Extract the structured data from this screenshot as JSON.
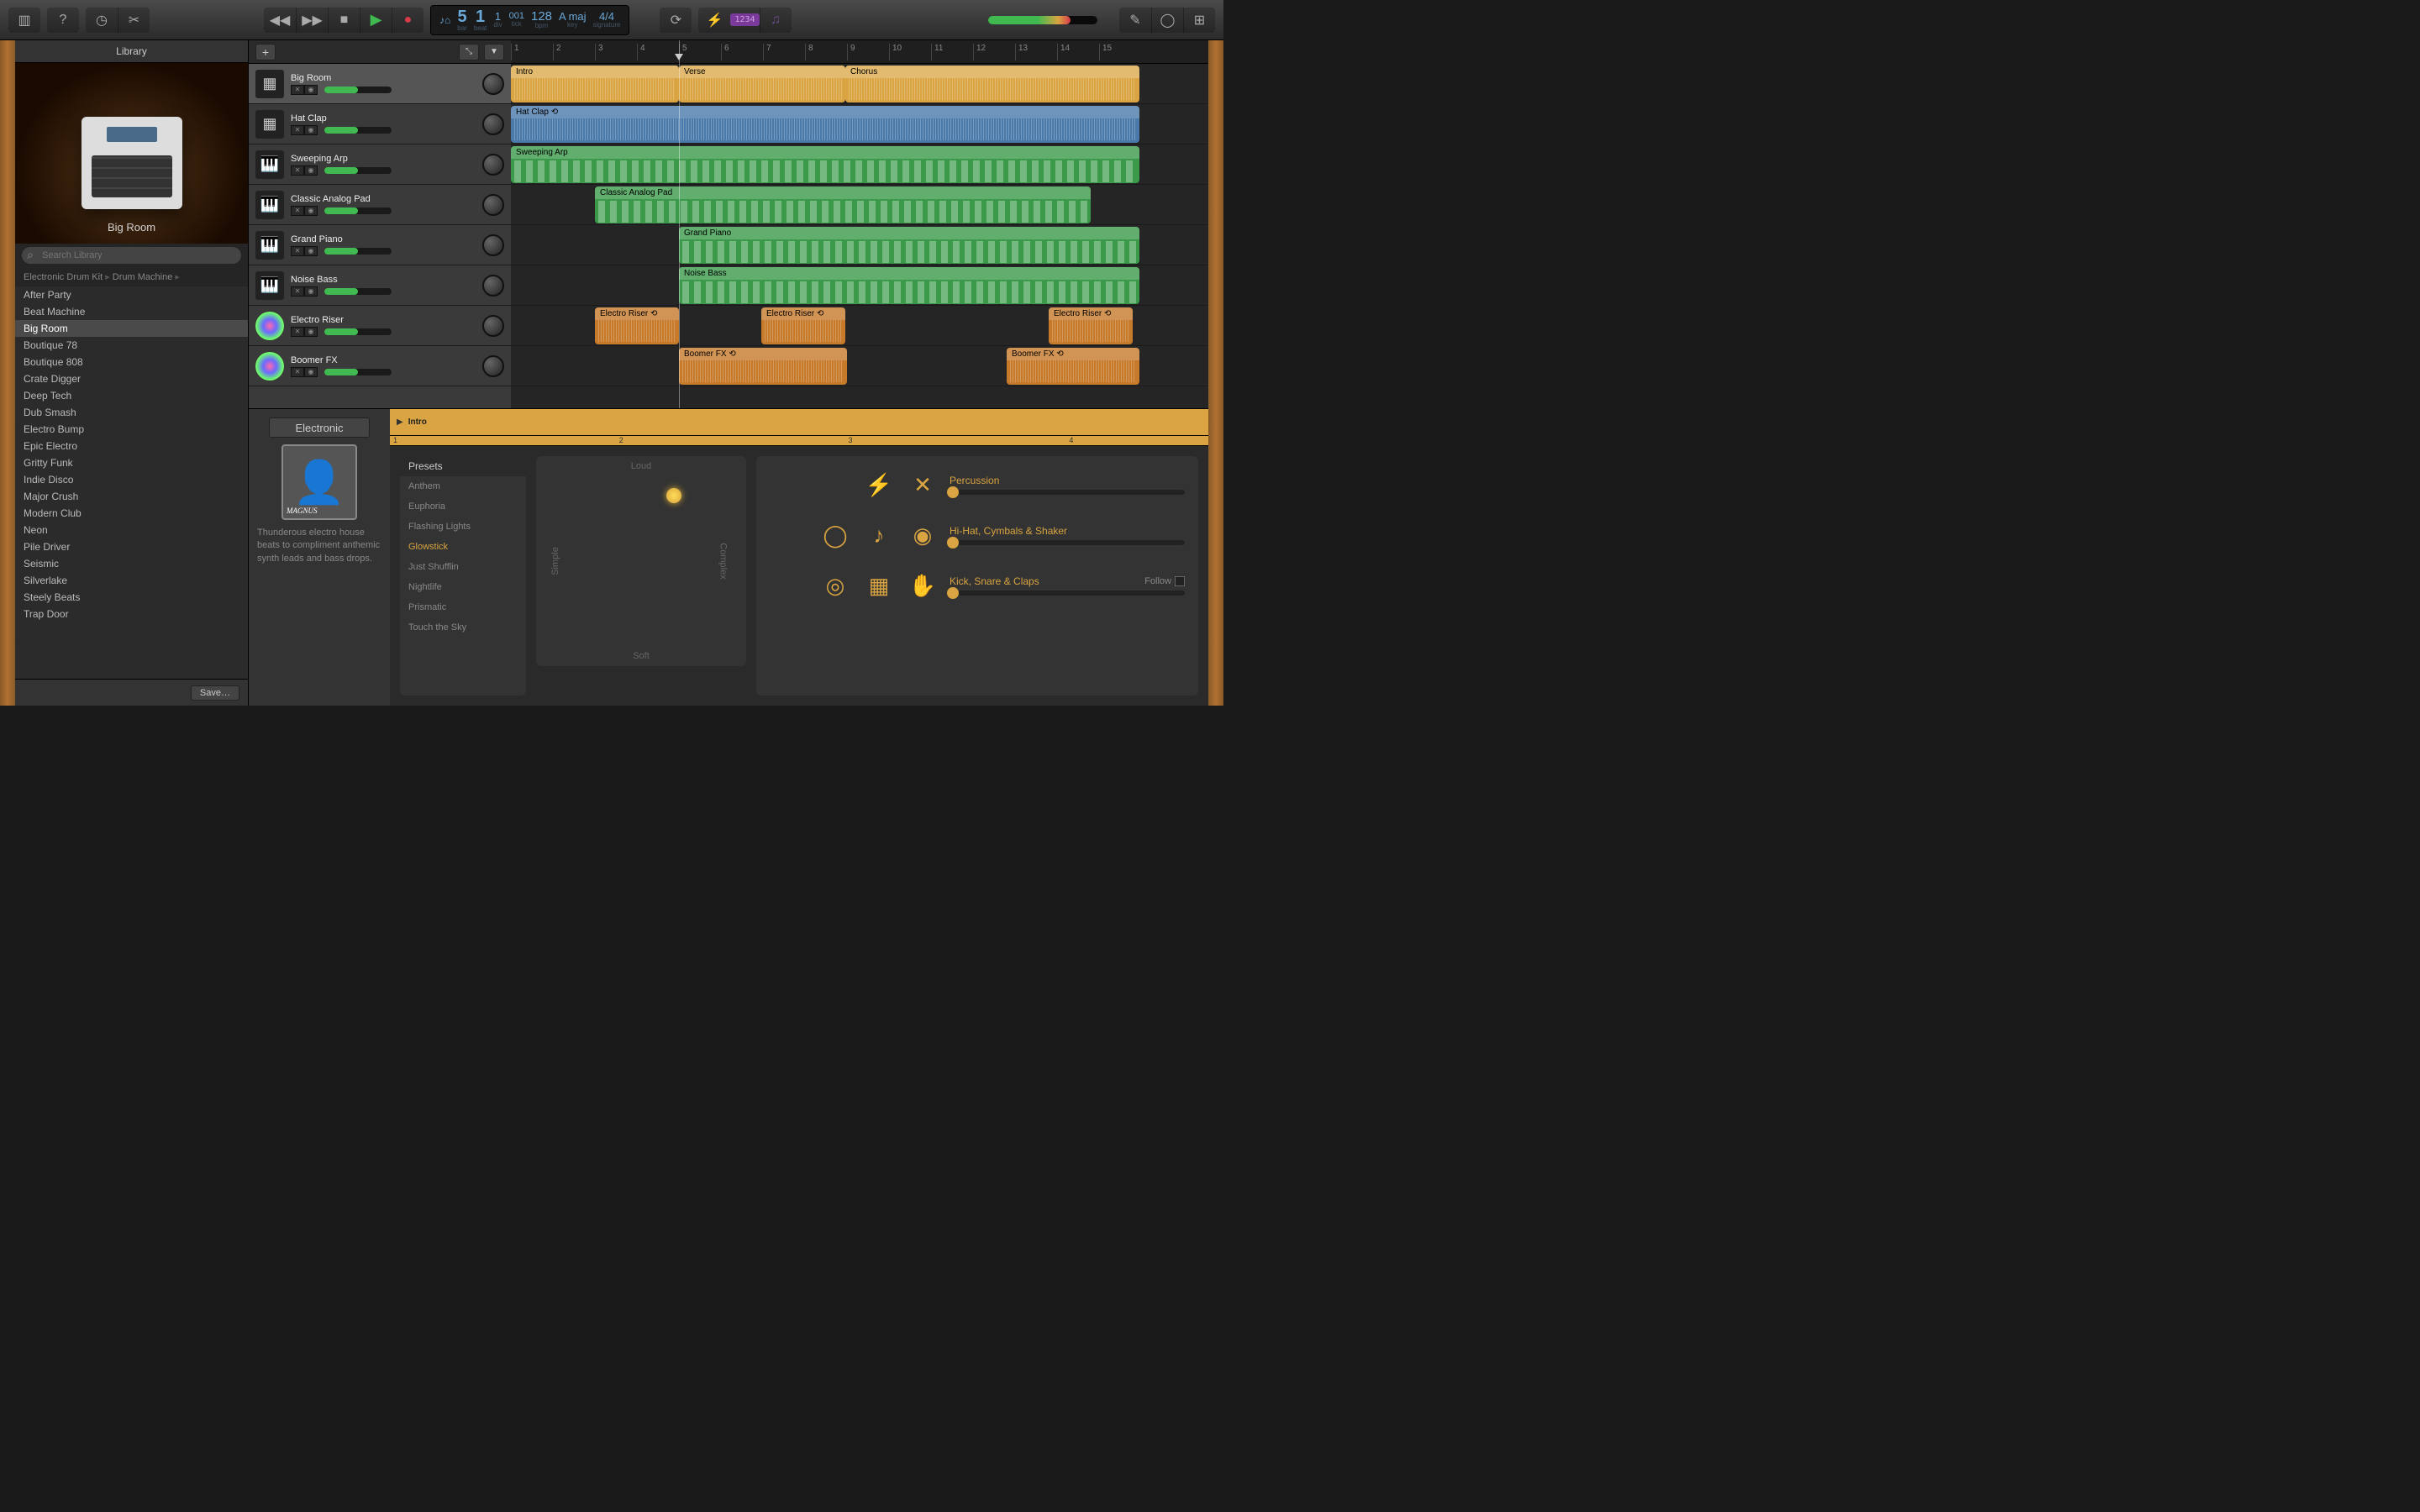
{
  "toolbar": {
    "transport": {
      "bar": "5",
      "beat": "1",
      "div": "1",
      "tick": "001",
      "bpm": "128",
      "key": "A maj",
      "sig": "4/4"
    },
    "labels": {
      "bar": "bar",
      "beat": "beat",
      "div": "div",
      "tick": "tick",
      "bpm": "bpm",
      "key": "key",
      "sig": "signature"
    },
    "count_in": "1234"
  },
  "library": {
    "title": "Library",
    "preview_name": "Big Room",
    "search_placeholder": "Search Library",
    "breadcrumb": [
      "Electronic Drum Kit",
      "Drum Machine"
    ],
    "items": [
      "After Party",
      "Beat Machine",
      "Big Room",
      "Boutique 78",
      "Boutique 808",
      "Crate Digger",
      "Deep Tech",
      "Dub Smash",
      "Electro Bump",
      "Epic Electro",
      "Gritty Funk",
      "Indie Disco",
      "Major Crush",
      "Modern Club",
      "Neon",
      "Pile Driver",
      "Seismic",
      "Silverlake",
      "Steely Beats",
      "Trap Door"
    ],
    "selected": "Big Room",
    "save_label": "Save…"
  },
  "tracks": [
    {
      "name": "Big Room",
      "icon": "drum-machine",
      "color": "yellow"
    },
    {
      "name": "Hat Clap",
      "icon": "drum-machine",
      "color": "blue"
    },
    {
      "name": "Sweeping Arp",
      "icon": "synth",
      "color": "green"
    },
    {
      "name": "Classic Analog Pad",
      "icon": "synth",
      "color": "green"
    },
    {
      "name": "Grand Piano",
      "icon": "piano",
      "color": "green"
    },
    {
      "name": "Noise Bass",
      "icon": "synth",
      "color": "green"
    },
    {
      "name": "Electro Riser",
      "icon": "fx",
      "color": "orange"
    },
    {
      "name": "Boomer FX",
      "icon": "fx",
      "color": "orange"
    }
  ],
  "ruler_marks": [
    1,
    2,
    3,
    4,
    5,
    6,
    7,
    8,
    9,
    10,
    11,
    12,
    13,
    14,
    15
  ],
  "regions": [
    {
      "track": 0,
      "label": "Intro",
      "color": "yellow",
      "start": 0,
      "len": 200,
      "type": "wave"
    },
    {
      "track": 0,
      "label": "Verse",
      "color": "yellow",
      "start": 200,
      "len": 198,
      "type": "wave"
    },
    {
      "track": 0,
      "label": "Chorus",
      "color": "yellow",
      "start": 398,
      "len": 350,
      "type": "wave"
    },
    {
      "track": 1,
      "label": "Hat Clap",
      "color": "blue",
      "start": 0,
      "len": 748,
      "type": "wave",
      "loop": true
    },
    {
      "track": 2,
      "label": "Sweeping Arp",
      "color": "green",
      "start": 0,
      "len": 748,
      "type": "midi"
    },
    {
      "track": 3,
      "label": "Classic Analog Pad",
      "color": "green",
      "start": 100,
      "len": 590,
      "type": "midi"
    },
    {
      "track": 4,
      "label": "Grand Piano",
      "color": "green",
      "start": 200,
      "len": 548,
      "type": "midi"
    },
    {
      "track": 5,
      "label": "Noise Bass",
      "color": "green",
      "start": 200,
      "len": 548,
      "type": "midi"
    },
    {
      "track": 6,
      "label": "Electro Riser",
      "color": "orange",
      "start": 100,
      "len": 100,
      "type": "wave",
      "loop": true
    },
    {
      "track": 6,
      "label": "Electro Riser",
      "color": "orange",
      "start": 298,
      "len": 100,
      "type": "wave",
      "loop": true
    },
    {
      "track": 6,
      "label": "Electro Riser",
      "color": "orange",
      "start": 640,
      "len": 100,
      "type": "wave",
      "loop": true
    },
    {
      "track": 7,
      "label": "Boomer FX",
      "color": "orange",
      "start": 200,
      "len": 200,
      "type": "wave",
      "loop": true
    },
    {
      "track": 7,
      "label": "Boomer FX",
      "color": "orange",
      "start": 590,
      "len": 158,
      "type": "wave",
      "loop": true
    }
  ],
  "drummer": {
    "genre_label": "Electronic",
    "artist": "Magnus",
    "description": "Thunderous electro house beats to compliment anthemic synth leads and bass drops.",
    "region_label": "Intro",
    "ruler_marks": [
      "1",
      "2",
      "3",
      "4"
    ],
    "presets_header": "Presets",
    "presets": [
      "Anthem",
      "Euphoria",
      "Flashing Lights",
      "Glowstick",
      "Just Shufflin",
      "Nightlife",
      "Prismatic",
      "Touch the Sky"
    ],
    "selected_preset": "Glowstick",
    "xy": {
      "loud": "Loud",
      "soft": "Soft",
      "simple": "Simple",
      "complex": "Complex"
    },
    "kits": [
      {
        "label": "Percussion",
        "icons": [
          "bolt",
          "sticks"
        ],
        "active": [
          false,
          true
        ]
      },
      {
        "label": "Hi-Hat, Cymbals & Shaker",
        "icons": [
          "tambourine",
          "shaker",
          "cymbal"
        ],
        "active": [
          true,
          true,
          true
        ]
      },
      {
        "label": "Kick, Snare & Claps",
        "icons": [
          "kick",
          "snare",
          "clap"
        ],
        "active": [
          true,
          true,
          true
        ],
        "follow": true
      }
    ],
    "follow_label": "Follow"
  }
}
